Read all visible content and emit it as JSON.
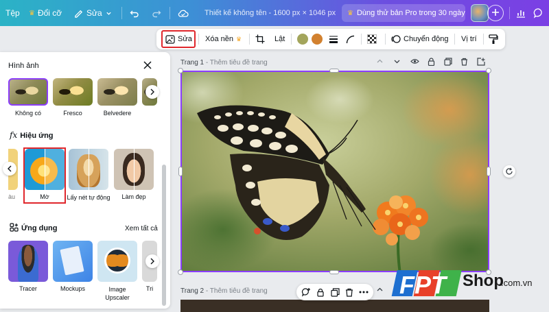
{
  "topbar": {
    "file_label": "Tệp",
    "resize_label": "Đổi cỡ",
    "edit_label": "Sửa",
    "doc_title": "Thiết kế không tên - 1600 px × 1046 px",
    "pro_label": "Dùng thử bản Pro trong 30 ngày",
    "icons": [
      "crown-icon",
      "pencil-icon",
      "undo-icon",
      "redo-icon",
      "cloud-icon",
      "plus-icon",
      "analytics-icon",
      "comment-icon"
    ]
  },
  "edit_toolbar": {
    "edit_label": "Sửa",
    "bg_remove_label": "Xóa nền",
    "flip_label": "Lật",
    "animate_label": "Chuyển động",
    "position_label": "Vị trí",
    "colors": {
      "swatch1": "#a3a55c",
      "swatch2": "#d2812f"
    },
    "highlight_color": "#e0262b"
  },
  "panel": {
    "title": "Hình ảnh",
    "filters": [
      {
        "label": "Không có"
      },
      {
        "label": "Fresco"
      },
      {
        "label": "Belvedere"
      }
    ],
    "effects_title": "Hiệu ứng",
    "effects_partial_label": "àu",
    "effects": [
      {
        "label": "Mờ"
      },
      {
        "label": "Lấy nét tự động"
      },
      {
        "label": "Làm đẹp"
      }
    ],
    "apps_title": "Ứng dụng",
    "see_all": "Xem tất cả",
    "apps": [
      {
        "label": "Tracer"
      },
      {
        "label": "Mockups"
      },
      {
        "label": "Image Upscaler"
      },
      {
        "label": "Tri"
      }
    ]
  },
  "canvas": {
    "page1_label": "Trang 1",
    "page1_sub": "- Thêm tiêu đề trang",
    "page2_label": "Trang 2",
    "page2_sub": "- Thêm tiêu đề trang",
    "selection_color": "#8b3dff"
  },
  "watermark": {
    "brand": "FPT",
    "shop": "Shop",
    "domain": ".com.vn",
    "colors": {
      "f": "#1e6fd0",
      "p": "#e8402a",
      "t": "#3fb24a"
    }
  }
}
